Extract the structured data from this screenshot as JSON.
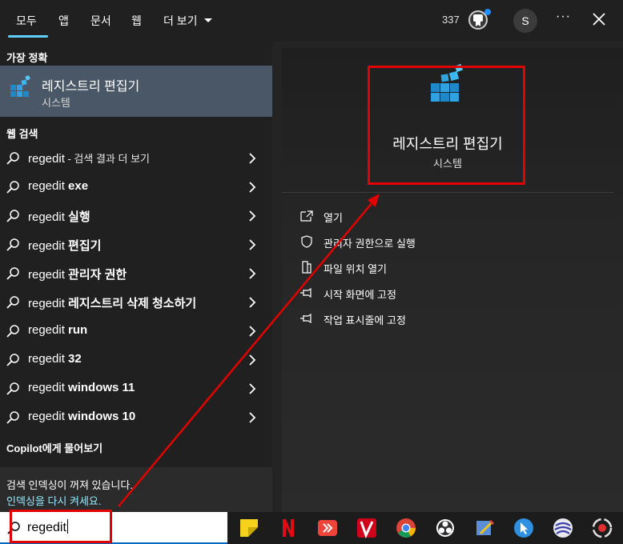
{
  "tabs": [
    {
      "label": "모두"
    },
    {
      "label": "앱"
    },
    {
      "label": "문서"
    },
    {
      "label": "웹"
    },
    {
      "label": "더 보기"
    }
  ],
  "header": {
    "count": "337",
    "avatar_letter": "S",
    "more": "···"
  },
  "best_match": {
    "heading": "가장 정확",
    "title": "레지스트리 편집기",
    "subtitle": "시스템"
  },
  "web": {
    "heading": "웹 검색",
    "items": [
      {
        "prefix": "regedit",
        "bold": "",
        "small": " - 검색 결과 더 보기"
      },
      {
        "prefix": "regedit ",
        "bold": "exe",
        "small": ""
      },
      {
        "prefix": "regedit ",
        "bold": "실행",
        "small": ""
      },
      {
        "prefix": "regedit ",
        "bold": "편집기",
        "small": ""
      },
      {
        "prefix": "regedit ",
        "bold": "관리자 권한",
        "small": ""
      },
      {
        "prefix": "regedit ",
        "bold": "레지스트리 삭제 청소하기",
        "small": ""
      },
      {
        "prefix": "regedit ",
        "bold": "run",
        "small": ""
      },
      {
        "prefix": "regedit ",
        "bold": "32",
        "small": ""
      },
      {
        "prefix": "regedit ",
        "bold": "windows 11",
        "small": ""
      },
      {
        "prefix": "regedit ",
        "bold": "windows 10",
        "small": ""
      }
    ]
  },
  "copilot": "Copilot에게 물어보기",
  "index_note": {
    "text": "검색 인덱싱이 꺼져 있습니다.",
    "link": "인덱싱을 다시 켜세요."
  },
  "detail": {
    "title": "레지스트리 편집기",
    "subtitle": "시스템",
    "actions": [
      {
        "label": "열기",
        "icon": "open-icon"
      },
      {
        "label": "관리자 권한으로 실행",
        "icon": "shield-icon"
      },
      {
        "label": "파일 위치 열기",
        "icon": "folder-icon"
      },
      {
        "label": "시작 화면에 고정",
        "icon": "pin-icon"
      },
      {
        "label": "작업 표시줄에 고정",
        "icon": "pin-icon"
      }
    ]
  },
  "search": {
    "value": "regedit"
  },
  "taskbar_icons": [
    "sticky-notes-icon",
    "netflix-icon",
    "anydesk-icon",
    "vivino-icon",
    "chrome-icon",
    "obs-icon",
    "editor-icon",
    "cursor-app-icon",
    "sphere-app-icon",
    "recorder-icon"
  ],
  "colors": {
    "accent": "#60cdff",
    "selection": "#4a5766",
    "annotation": "#e30000",
    "link": "#99ebff"
  }
}
